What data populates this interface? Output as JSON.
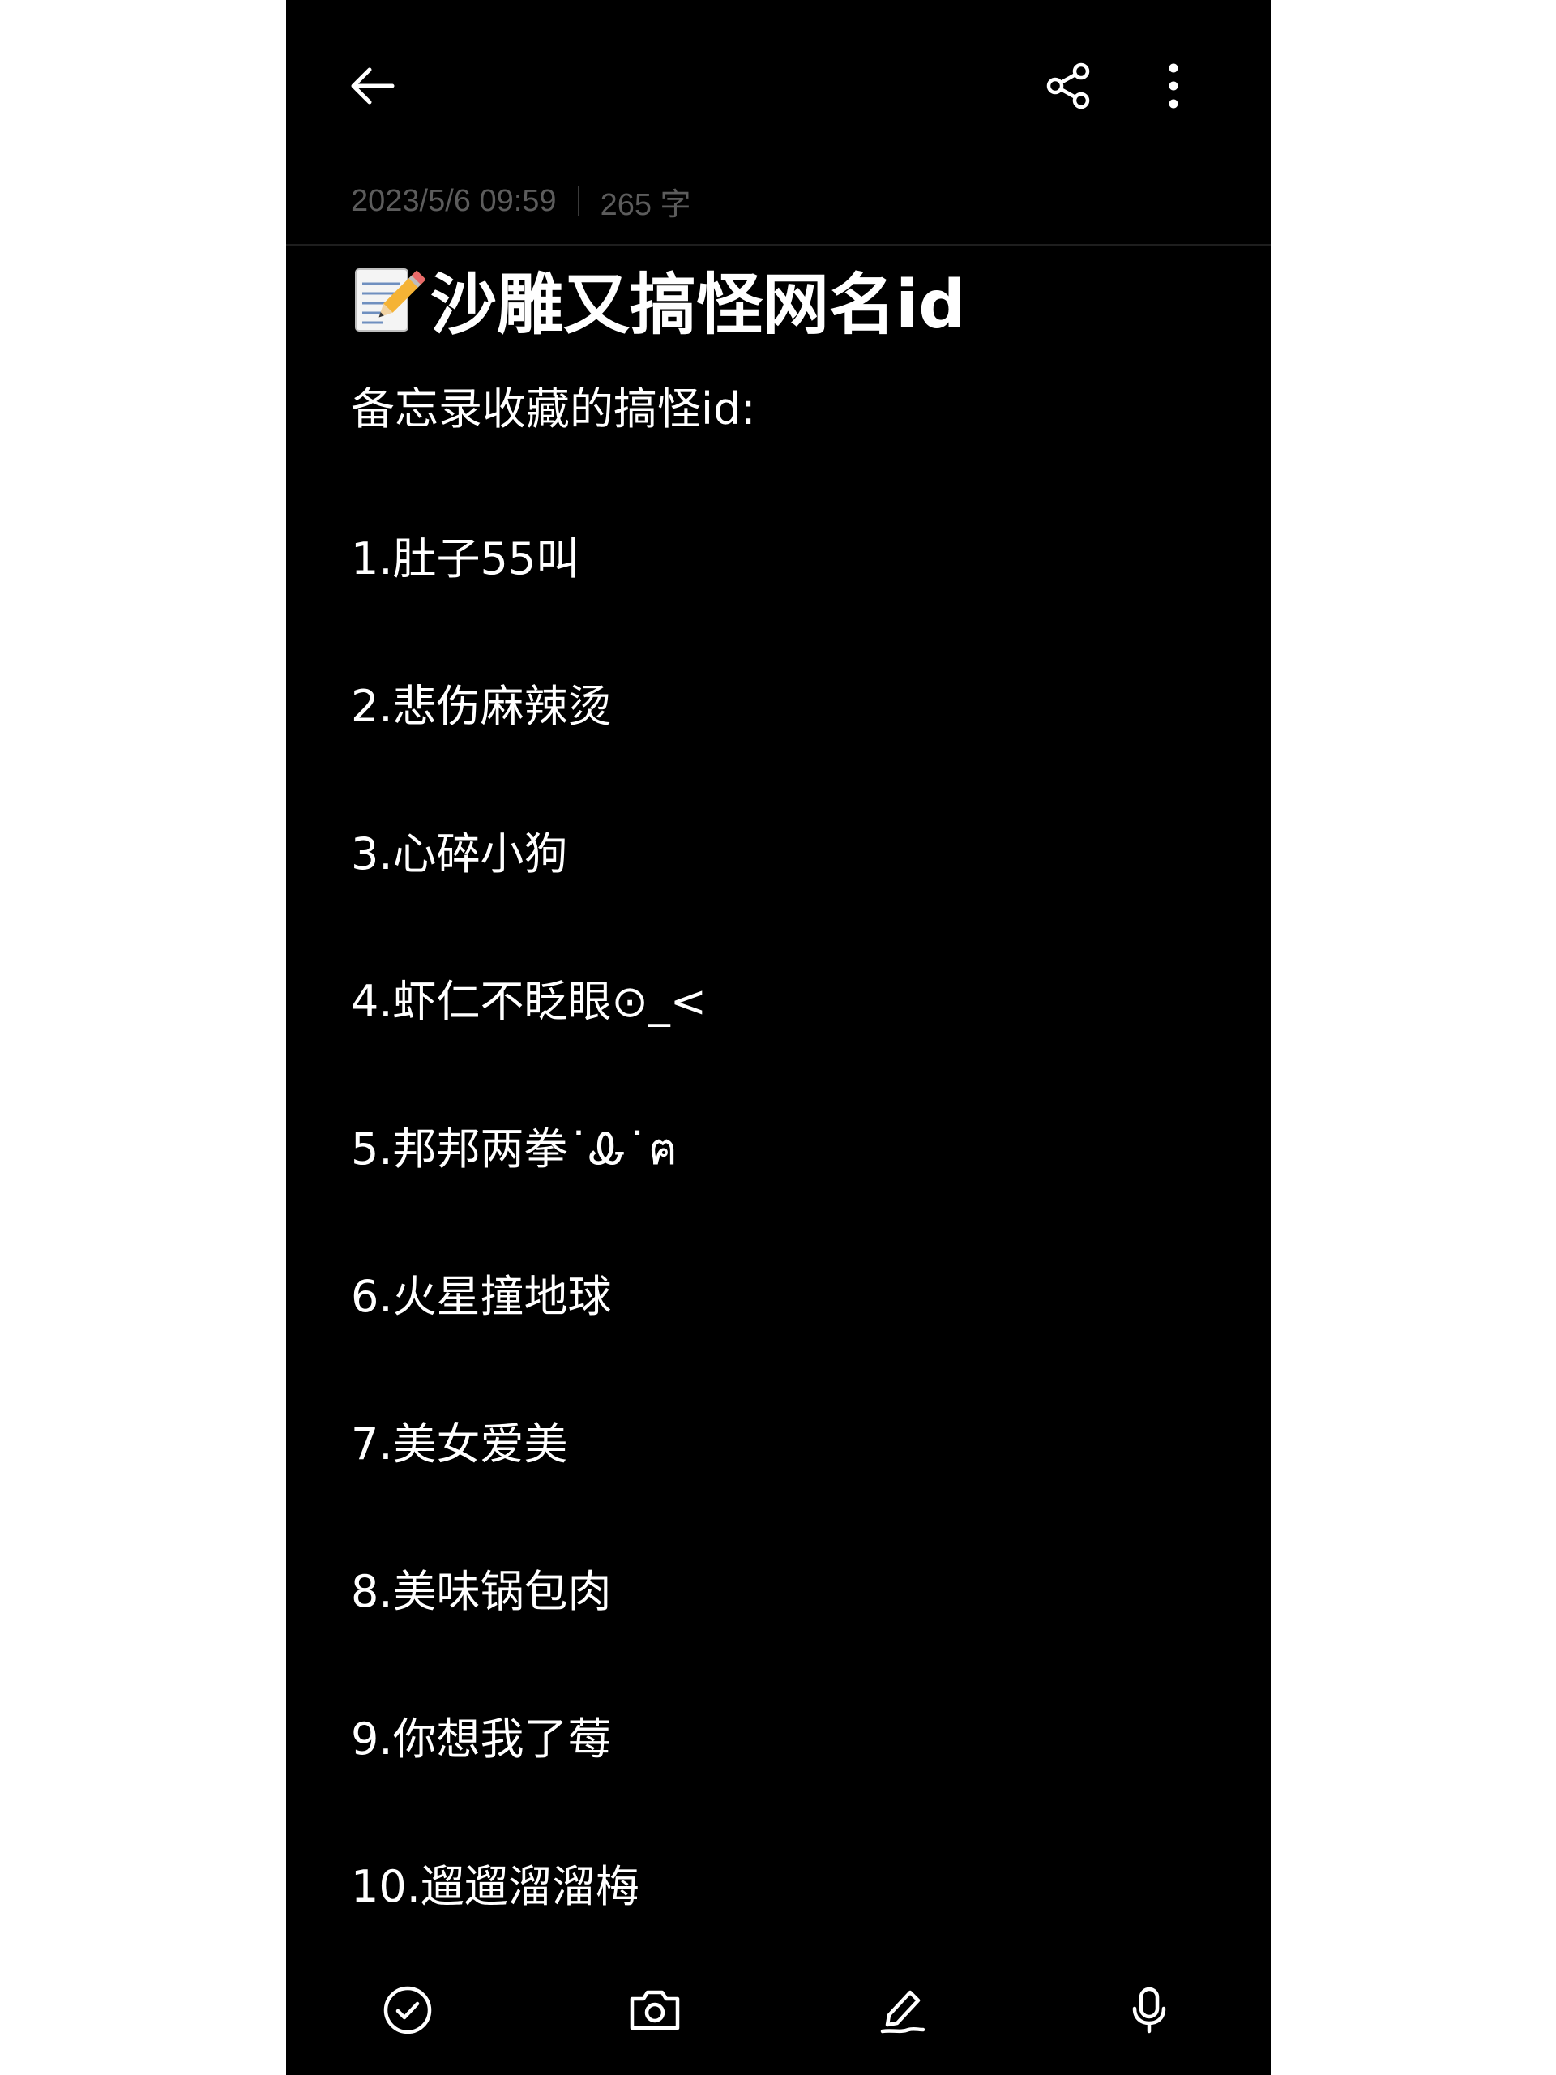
{
  "header": {
    "back_icon": "arrow-left-icon",
    "share_icon": "share-icon",
    "more_icon": "more-vertical-icon"
  },
  "meta": {
    "datetime": "2023/5/6 09:59",
    "word_count": "265 字"
  },
  "note": {
    "title_icon": "memo-pencil-icon",
    "title": "沙雕又搞怪网名id",
    "intro": "备忘录收藏的搞怪id:",
    "items": [
      "1.肚子55叫",
      "2.悲伤麻辣烫",
      "3.心碎小狗",
      "4.虾仁不眨眼⊙_<",
      "5.邦邦两拳˙Ꮂ˙ฅ",
      "6.火星撞地球",
      "7.美女爱美",
      "8.美味锅包肉",
      "9.你想我了莓",
      "10.遛遛溜溜梅"
    ]
  },
  "toolbar": {
    "checklist_icon": "check-circle-icon",
    "camera_icon": "camera-icon",
    "handwrite_icon": "pen-icon",
    "voice_icon": "microphone-icon"
  },
  "colors": {
    "background": "#000000",
    "text": "#ffffff",
    "meta_text": "#5c5c5c"
  }
}
